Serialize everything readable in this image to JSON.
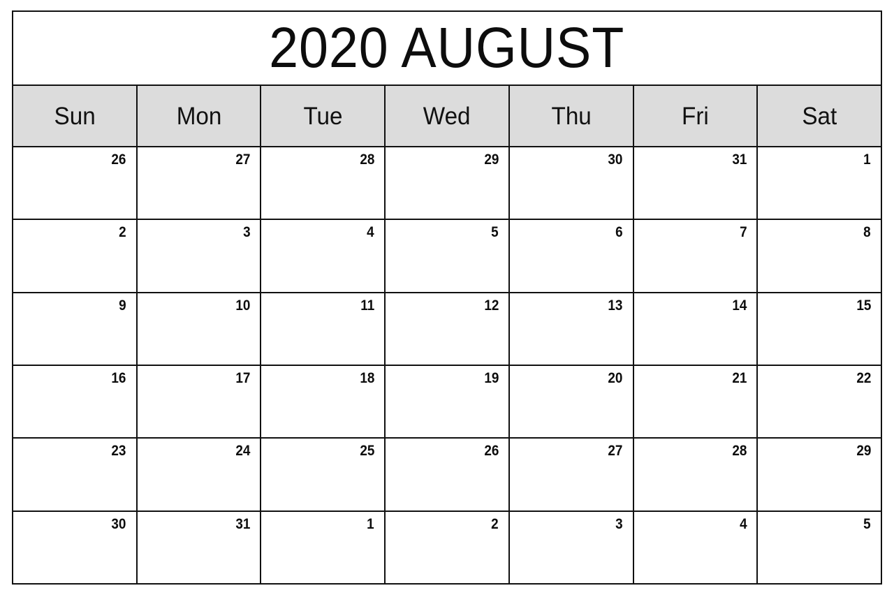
{
  "calendar": {
    "title": "2020 AUGUST",
    "year": "2020",
    "month_name": "AUGUST",
    "colors": {
      "header_background": "#dcdcdc",
      "grid_line": "#111111",
      "text": "#0d0d0d",
      "page_background": "#ffffff"
    },
    "weekdays": [
      {
        "label": "Sun"
      },
      {
        "label": "Mon"
      },
      {
        "label": "Tue"
      },
      {
        "label": "Wed"
      },
      {
        "label": "Thu"
      },
      {
        "label": "Fri"
      },
      {
        "label": "Sat"
      }
    ],
    "weeks": [
      {
        "days": [
          {
            "number": "26",
            "in_month": false
          },
          {
            "number": "27",
            "in_month": false
          },
          {
            "number": "28",
            "in_month": false
          },
          {
            "number": "29",
            "in_month": false
          },
          {
            "number": "30",
            "in_month": false
          },
          {
            "number": "31",
            "in_month": false
          },
          {
            "number": "1",
            "in_month": true
          }
        ]
      },
      {
        "days": [
          {
            "number": "2",
            "in_month": true
          },
          {
            "number": "3",
            "in_month": true
          },
          {
            "number": "4",
            "in_month": true
          },
          {
            "number": "5",
            "in_month": true
          },
          {
            "number": "6",
            "in_month": true
          },
          {
            "number": "7",
            "in_month": true
          },
          {
            "number": "8",
            "in_month": true
          }
        ]
      },
      {
        "days": [
          {
            "number": "9",
            "in_month": true
          },
          {
            "number": "10",
            "in_month": true
          },
          {
            "number": "11",
            "in_month": true
          },
          {
            "number": "12",
            "in_month": true
          },
          {
            "number": "13",
            "in_month": true
          },
          {
            "number": "14",
            "in_month": true
          },
          {
            "number": "15",
            "in_month": true
          }
        ]
      },
      {
        "days": [
          {
            "number": "16",
            "in_month": true
          },
          {
            "number": "17",
            "in_month": true
          },
          {
            "number": "18",
            "in_month": true
          },
          {
            "number": "19",
            "in_month": true
          },
          {
            "number": "20",
            "in_month": true
          },
          {
            "number": "21",
            "in_month": true
          },
          {
            "number": "22",
            "in_month": true
          }
        ]
      },
      {
        "days": [
          {
            "number": "23",
            "in_month": true
          },
          {
            "number": "24",
            "in_month": true
          },
          {
            "number": "25",
            "in_month": true
          },
          {
            "number": "26",
            "in_month": true
          },
          {
            "number": "27",
            "in_month": true
          },
          {
            "number": "28",
            "in_month": true
          },
          {
            "number": "29",
            "in_month": true
          }
        ]
      },
      {
        "days": [
          {
            "number": "30",
            "in_month": true
          },
          {
            "number": "31",
            "in_month": true
          },
          {
            "number": "1",
            "in_month": false
          },
          {
            "number": "2",
            "in_month": false
          },
          {
            "number": "3",
            "in_month": false
          },
          {
            "number": "4",
            "in_month": false
          },
          {
            "number": "5",
            "in_month": false
          }
        ]
      }
    ]
  }
}
